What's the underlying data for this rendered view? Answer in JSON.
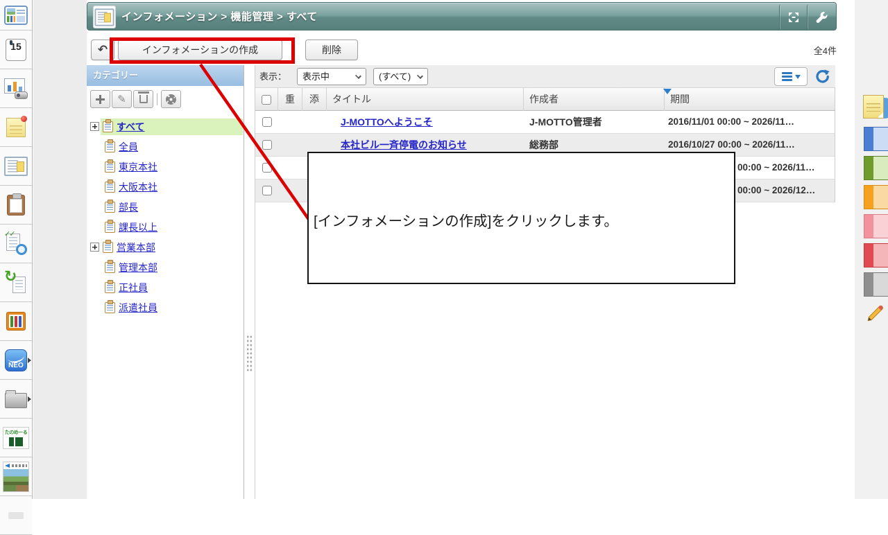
{
  "colors": {
    "highlight_red": "#dd0000",
    "header_teal": "#6e9996",
    "category_header_blue": "#a6c8e6",
    "selected_green": "#daf3bd",
    "link_blue": "#2525c8",
    "accent_blue": "#2e78c0"
  },
  "dock": {
    "calendar_day": "15",
    "neo_label": "NEO",
    "tanomeru_label": "たのめーる"
  },
  "header": {
    "title": "インフォメーション > 機能管理 > すべて"
  },
  "toolbar": {
    "create_button": "インフォメーションの作成",
    "delete_button": "削除",
    "total_count": "全4件"
  },
  "category_panel": {
    "title": "カテゴリー",
    "items": [
      {
        "label": "すべて",
        "expandable": true,
        "selected": true
      },
      {
        "label": "全員",
        "expandable": false,
        "selected": false
      },
      {
        "label": "東京本社",
        "expandable": false,
        "selected": false
      },
      {
        "label": "大阪本社",
        "expandable": false,
        "selected": false
      },
      {
        "label": "部長",
        "expandable": false,
        "selected": false
      },
      {
        "label": "課長以上",
        "expandable": false,
        "selected": false
      },
      {
        "label": "営業本部",
        "expandable": true,
        "selected": false
      },
      {
        "label": "管理本部",
        "expandable": false,
        "selected": false
      },
      {
        "label": "正社員",
        "expandable": false,
        "selected": false
      },
      {
        "label": "派遣社員",
        "expandable": false,
        "selected": false
      }
    ]
  },
  "list": {
    "filter": {
      "label": "表示：",
      "status_value": "表示中",
      "scope_value": "(すべて)"
    },
    "columns": {
      "important": "重",
      "attachment": "添",
      "title": "タイトル",
      "creator": "作成者",
      "period": "期間"
    },
    "rows": [
      {
        "title": "J-MOTTOへようこそ",
        "creator": "J-MOTTO管理者",
        "period": "2016/11/01 00:00 ~ 2026/11…"
      },
      {
        "title": "本社ビル一斉停電のお知らせ",
        "creator": "総務部",
        "period": "2016/10/27 00:00 ~ 2026/11…"
      },
      {
        "title": "",
        "creator": "",
        "period": "00:00 ~ 2026/11…"
      },
      {
        "title": "",
        "creator": "",
        "period": "00:00 ~ 2026/12…"
      }
    ]
  },
  "annotation": {
    "tooltip_text": "[インフォメーションの作成]をクリックします。"
  }
}
